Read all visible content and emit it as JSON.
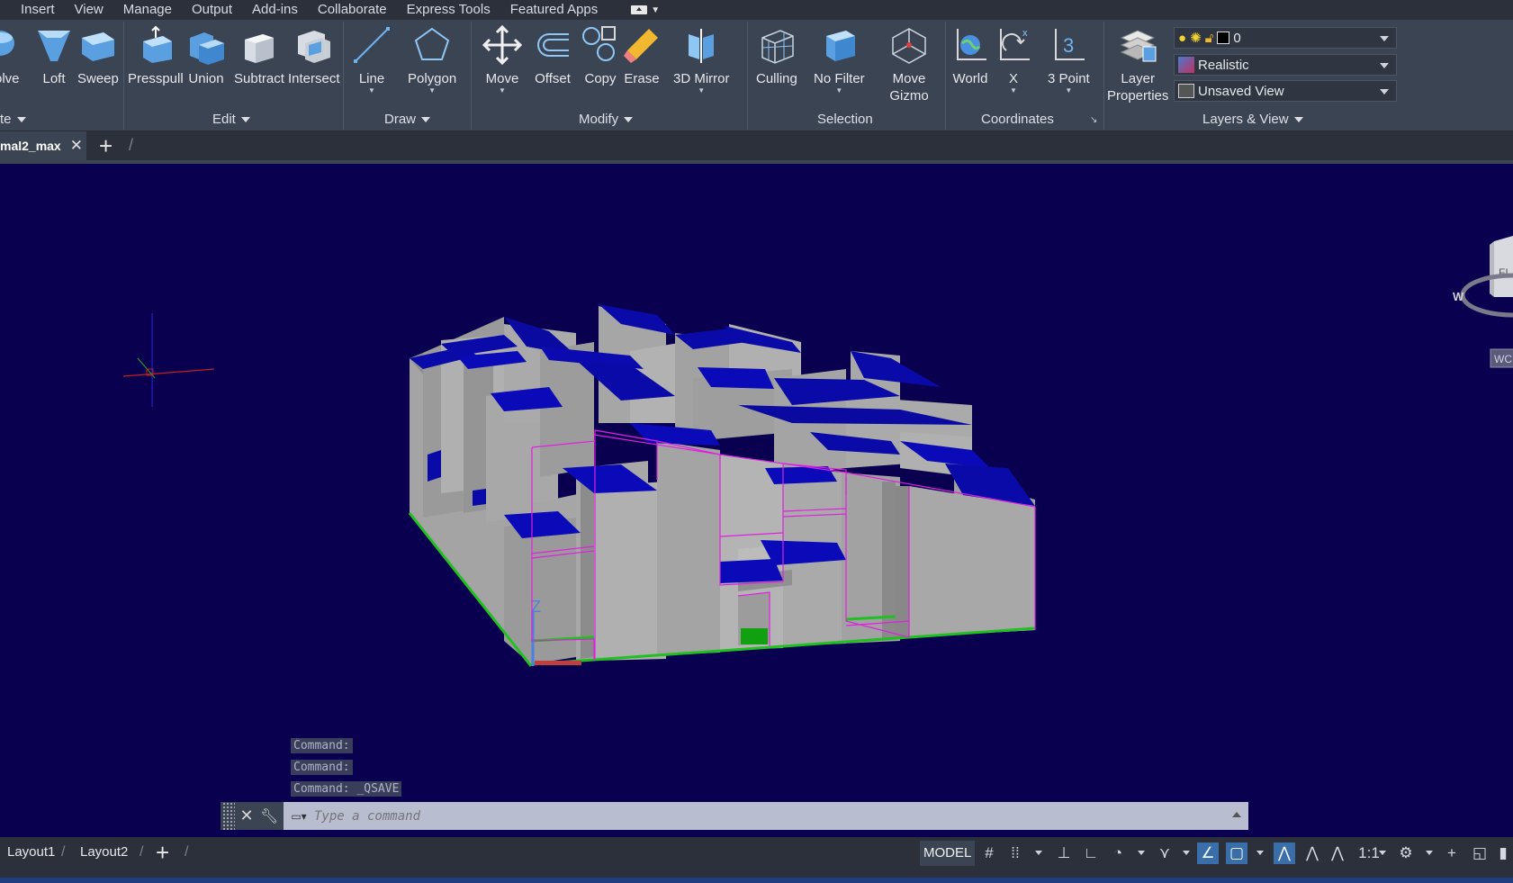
{
  "menu": [
    "Insert",
    "View",
    "Manage",
    "Output",
    "Add-ins",
    "Collaborate",
    "Express Tools",
    "Featured Apps"
  ],
  "ribbon": {
    "create": {
      "tools": [
        "volve",
        "Loft",
        "Sweep"
      ],
      "title": "te"
    },
    "edit": {
      "tools": [
        "Presspull",
        "Union",
        "Subtract",
        "Intersect"
      ],
      "title": "Edit"
    },
    "draw": {
      "tools": [
        "Line",
        "Polygon"
      ],
      "title": "Draw"
    },
    "modify": {
      "tools": [
        "Move",
        "Offset",
        "Copy",
        "Erase",
        "3D Mirror"
      ],
      "title": "Modify"
    },
    "selection": {
      "culling": "Culling",
      "nofilter": "No Filter",
      "gizmo_1": "Move",
      "gizmo_2": "Gizmo",
      "title": "Selection"
    },
    "coordinates": {
      "tools": [
        "World",
        "X",
        "3 Point"
      ],
      "title": "Coordinates",
      "three": "3",
      "xlabel": "x"
    },
    "layers": {
      "props_1": "Layer",
      "props_2": "Properties",
      "layer_value": "0",
      "visual_style": "Realistic",
      "view": "Unsaved View",
      "title": "Layers & View"
    }
  },
  "tabs": {
    "doc": "mal2_max",
    "close": "✕",
    "new": "+"
  },
  "viewcube": {
    "face": "FI",
    "compass": "W",
    "wcs": "WC"
  },
  "command": {
    "history": [
      "Command:",
      "Command:",
      "Command: _QSAVE"
    ],
    "placeholder": "Type a command"
  },
  "status": {
    "layouts": [
      "Layout1",
      "Layout2"
    ],
    "model": "MODEL",
    "scale": "1:1"
  },
  "colors": {
    "background": "#0a0050",
    "roof": "#0a0aa8",
    "wall": "#a0a0a0",
    "selection": "#e020e0",
    "edge": "#20c020"
  }
}
